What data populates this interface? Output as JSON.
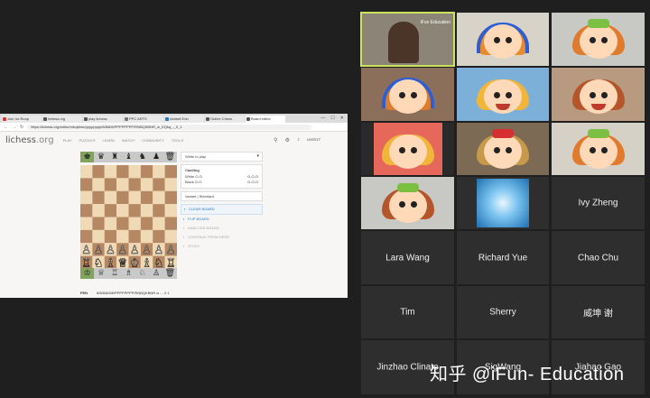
{
  "browser": {
    "tabs": [
      "Join Us Roop",
      "lichess.org",
      "play lichess",
      "PPC ARTS",
      "chatwit Edu",
      "Online Chess",
      "Board editor"
    ],
    "url": "https://lichess.org/editor/rnbqkbnr/pppppppp/8/8/8/8/PPPPPPPP/RNBQKBNR_w_KQkq_-_0_1"
  },
  "lichess": {
    "logo_main": "lichess",
    "logo_tld": ".org",
    "nav": [
      "PLAY",
      "PUZZLES",
      "LEARN",
      "WATCH",
      "COMMUNITY",
      "TOOLS"
    ],
    "user": "ueeb17",
    "panel": {
      "turn": "White to play",
      "castling_title": "Castling",
      "white_castling": "White O-O",
      "white_long": "O-O-O",
      "black_castling": "Black O-O",
      "black_long": "O-O-O",
      "variant": "Variant | Standard",
      "buttons": [
        "CLEAR BOARD",
        "FLIP BOARD",
        "ANALYSIS BOARD",
        "CONTINUE FROM HERE",
        "STUDY"
      ]
    },
    "fen_label": "FEN",
    "fen": "8/8/8/8/8/8/PPPPPPPP/RNBQKBNR w - - 0 1",
    "footnote": "Parents online",
    "spare_top": [
      "♚",
      "♛",
      "♜",
      "♝",
      "♞",
      "♟",
      "🗑"
    ],
    "spare_bottom": [
      "♔",
      "♕",
      "♖",
      "♗",
      "♘",
      "♙",
      "🗑"
    ]
  },
  "participants": {
    "names": {
      "ivy": "Ivy Zheng",
      "lara": "Lara Wang",
      "richard": "Richard Yue",
      "chao": "Chao Chu",
      "tim": "Tim",
      "sherry": "Sherry",
      "weikun": "威坤 谢",
      "jinzhao": "Jinzhao Clinate",
      "sigwang": "SigWang",
      "jiahao": "Jiahao Gao"
    },
    "host_logo": "iFun Education"
  },
  "watermark": "知乎 @iFun- Education",
  "colors": {
    "active_speaker": "#c9e45b",
    "board_light": "#f0d9b5",
    "board_dark": "#b58863",
    "selected_spare": "#82a35c"
  }
}
